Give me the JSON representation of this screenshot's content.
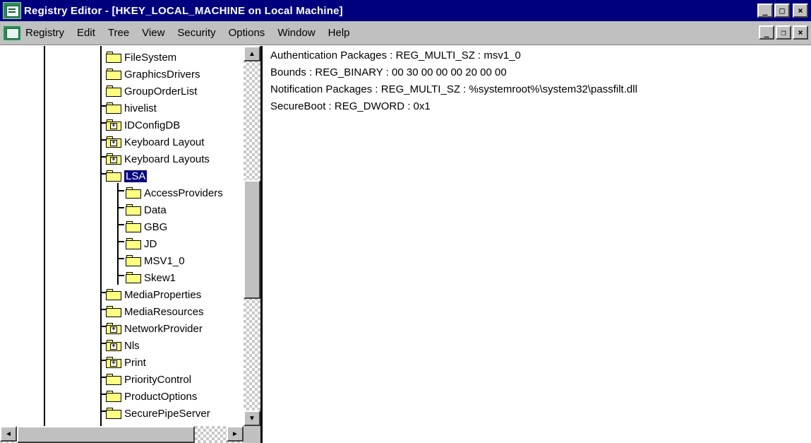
{
  "window": {
    "title": "Registry Editor - [HKEY_LOCAL_MACHINE on Local Machine]",
    "controls": {
      "minimize": "_",
      "maximize": "□",
      "close": "×"
    }
  },
  "menubar": {
    "items": [
      "Registry",
      "Edit",
      "Tree",
      "View",
      "Security",
      "Options",
      "Window",
      "Help"
    ],
    "mdi_controls": {
      "minimize": "_",
      "restore": "❐",
      "close": "×"
    }
  },
  "tree": {
    "items": [
      {
        "label": "FileSystem",
        "icon": "folder-icon"
      },
      {
        "label": "GraphicsDrivers",
        "icon": "folder-icon"
      },
      {
        "label": "GroupOrderList",
        "icon": "folder-icon"
      },
      {
        "label": "hivelist",
        "icon": "folder-icon"
      },
      {
        "label": "IDConfigDB",
        "icon": "folder-plus-icon"
      },
      {
        "label": "Keyboard Layout",
        "icon": "folder-plus-icon"
      },
      {
        "label": "Keyboard Layouts",
        "icon": "folder-plus-icon"
      },
      {
        "label": "LSA",
        "icon": "folder-open-icon",
        "selected": true
      },
      {
        "label": "AccessProviders",
        "icon": "folder-icon"
      },
      {
        "label": "Data",
        "icon": "folder-icon"
      },
      {
        "label": "GBG",
        "icon": "folder-icon"
      },
      {
        "label": "JD",
        "icon": "folder-icon"
      },
      {
        "label": "MSV1_0",
        "icon": "folder-icon"
      },
      {
        "label": "Skew1",
        "icon": "folder-icon"
      },
      {
        "label": "MediaProperties",
        "icon": "folder-icon"
      },
      {
        "label": "MediaResources",
        "icon": "folder-icon"
      },
      {
        "label": "NetworkProvider",
        "icon": "folder-plus-icon"
      },
      {
        "label": "Nls",
        "icon": "folder-plus-icon"
      },
      {
        "label": "Print",
        "icon": "folder-plus-icon"
      },
      {
        "label": "PriorityControl",
        "icon": "folder-icon"
      },
      {
        "label": "ProductOptions",
        "icon": "folder-icon"
      },
      {
        "label": "SecurePipeServer",
        "icon": "folder-icon"
      }
    ]
  },
  "values": [
    "Authentication Packages : REG_MULTI_SZ : msv1_0",
    "Bounds : REG_BINARY : 00 30 00 00 00 20 00 00",
    "Notification Packages : REG_MULTI_SZ : %systemroot%\\system32\\passfilt.dll",
    "SecureBoot : REG_DWORD : 0x1"
  ],
  "scrollbars": {
    "up": "▲",
    "down": "▼",
    "left": "◄",
    "right": "►"
  },
  "colors": {
    "titlebar": "#00007f",
    "selection": "#00007f",
    "chrome": "#c0c0c0",
    "folder": "#ffff80"
  }
}
